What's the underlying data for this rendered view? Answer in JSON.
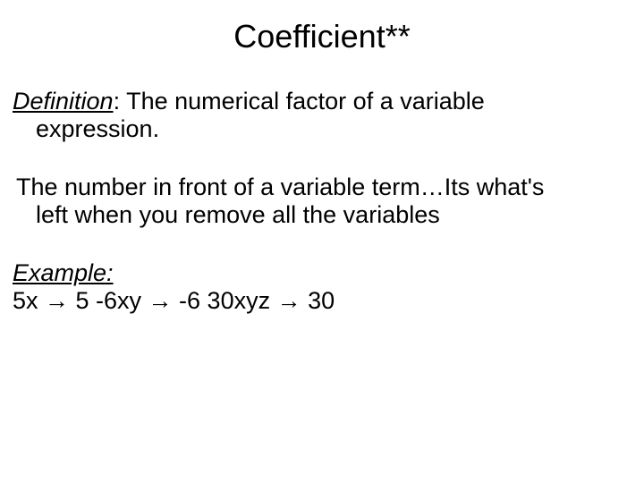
{
  "title": "Coefficient**",
  "definition": {
    "label": "Definition",
    "text_part1": ":  The numerical factor of a variable",
    "text_part2": "expression."
  },
  "explanation": {
    "line1": "The number in front of a variable term…Its what's",
    "line2": "left when you remove all the variables"
  },
  "example": {
    "label": "Example:",
    "text": "5x → 5   -6xy → -6   30xyz → 30"
  }
}
